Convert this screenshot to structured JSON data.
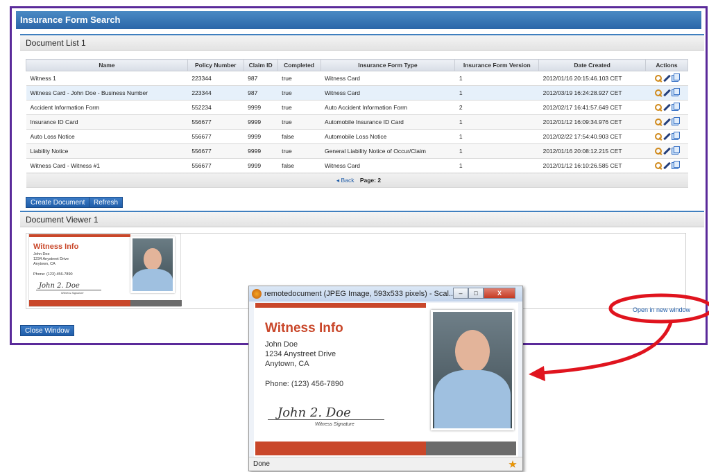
{
  "app": {
    "title": "Insurance Form Search"
  },
  "doc_list": {
    "title": "Document List 1",
    "columns": [
      "Name",
      "Policy Number",
      "Claim ID",
      "Completed",
      "Insurance Form Type",
      "Insurance Form Version",
      "Date Created",
      "Actions"
    ],
    "rows": [
      [
        "Witness 1",
        "223344",
        "987",
        "true",
        "Witness Card",
        "1",
        "2012/01/16 20:15:46.103 CET"
      ],
      [
        "Witness Card - John Doe - Business Number",
        "223344",
        "987",
        "true",
        "Witness Card",
        "1",
        "2012/03/19 16:24:28.927 CET"
      ],
      [
        "Accident Information Form",
        "552234",
        "9999",
        "true",
        "Auto Accident Information Form",
        "2",
        "2012/02/17 16:41:57.649 CET"
      ],
      [
        "Insurance ID Card",
        "556677",
        "9999",
        "true",
        "Automobile Insurance ID Card",
        "1",
        "2012/01/12 16:09:34.976 CET"
      ],
      [
        "Auto Loss Notice",
        "556677",
        "9999",
        "false",
        "Automobile Loss Notice",
        "1",
        "2012/02/22 17:54:40.903 CET"
      ],
      [
        "Liability Notice",
        "556677",
        "9999",
        "true",
        "General Liability Notice of Occur/Claim",
        "1",
        "2012/01/16 20:08:12.215 CET"
      ],
      [
        "Witness Card - Witness #1",
        "556677",
        "9999",
        "false",
        "Witness Card",
        "1",
        "2012/01/12 16:10:26.585 CET"
      ]
    ],
    "pager": {
      "back": "◂ Back",
      "page": "Page: 2"
    },
    "buttons": {
      "create": "Create Document",
      "refresh": "Refresh"
    }
  },
  "doc_viewer": {
    "title": "Document Viewer 1",
    "open_link": "Open in new window",
    "close_button": "Close Window"
  },
  "card": {
    "heading": "Witness Info",
    "name": "John Doe",
    "address1": "1234 Anystreet Drive",
    "address2": "Anytown, CA",
    "phone": "Phone: (123) 456-7890",
    "signature": "John 2. Doe",
    "signature_label": "Witness Signature"
  },
  "popup": {
    "title": "remotedocument (JPEG Image, 593x533 pixels) - Scal...",
    "status": "Done",
    "min": "–",
    "max": "□",
    "close": "X"
  },
  "colors": {
    "accent": "#2b66a8",
    "frame": "#5a2a9a",
    "card_red": "#c9472a",
    "annotation": "#e0141e"
  }
}
